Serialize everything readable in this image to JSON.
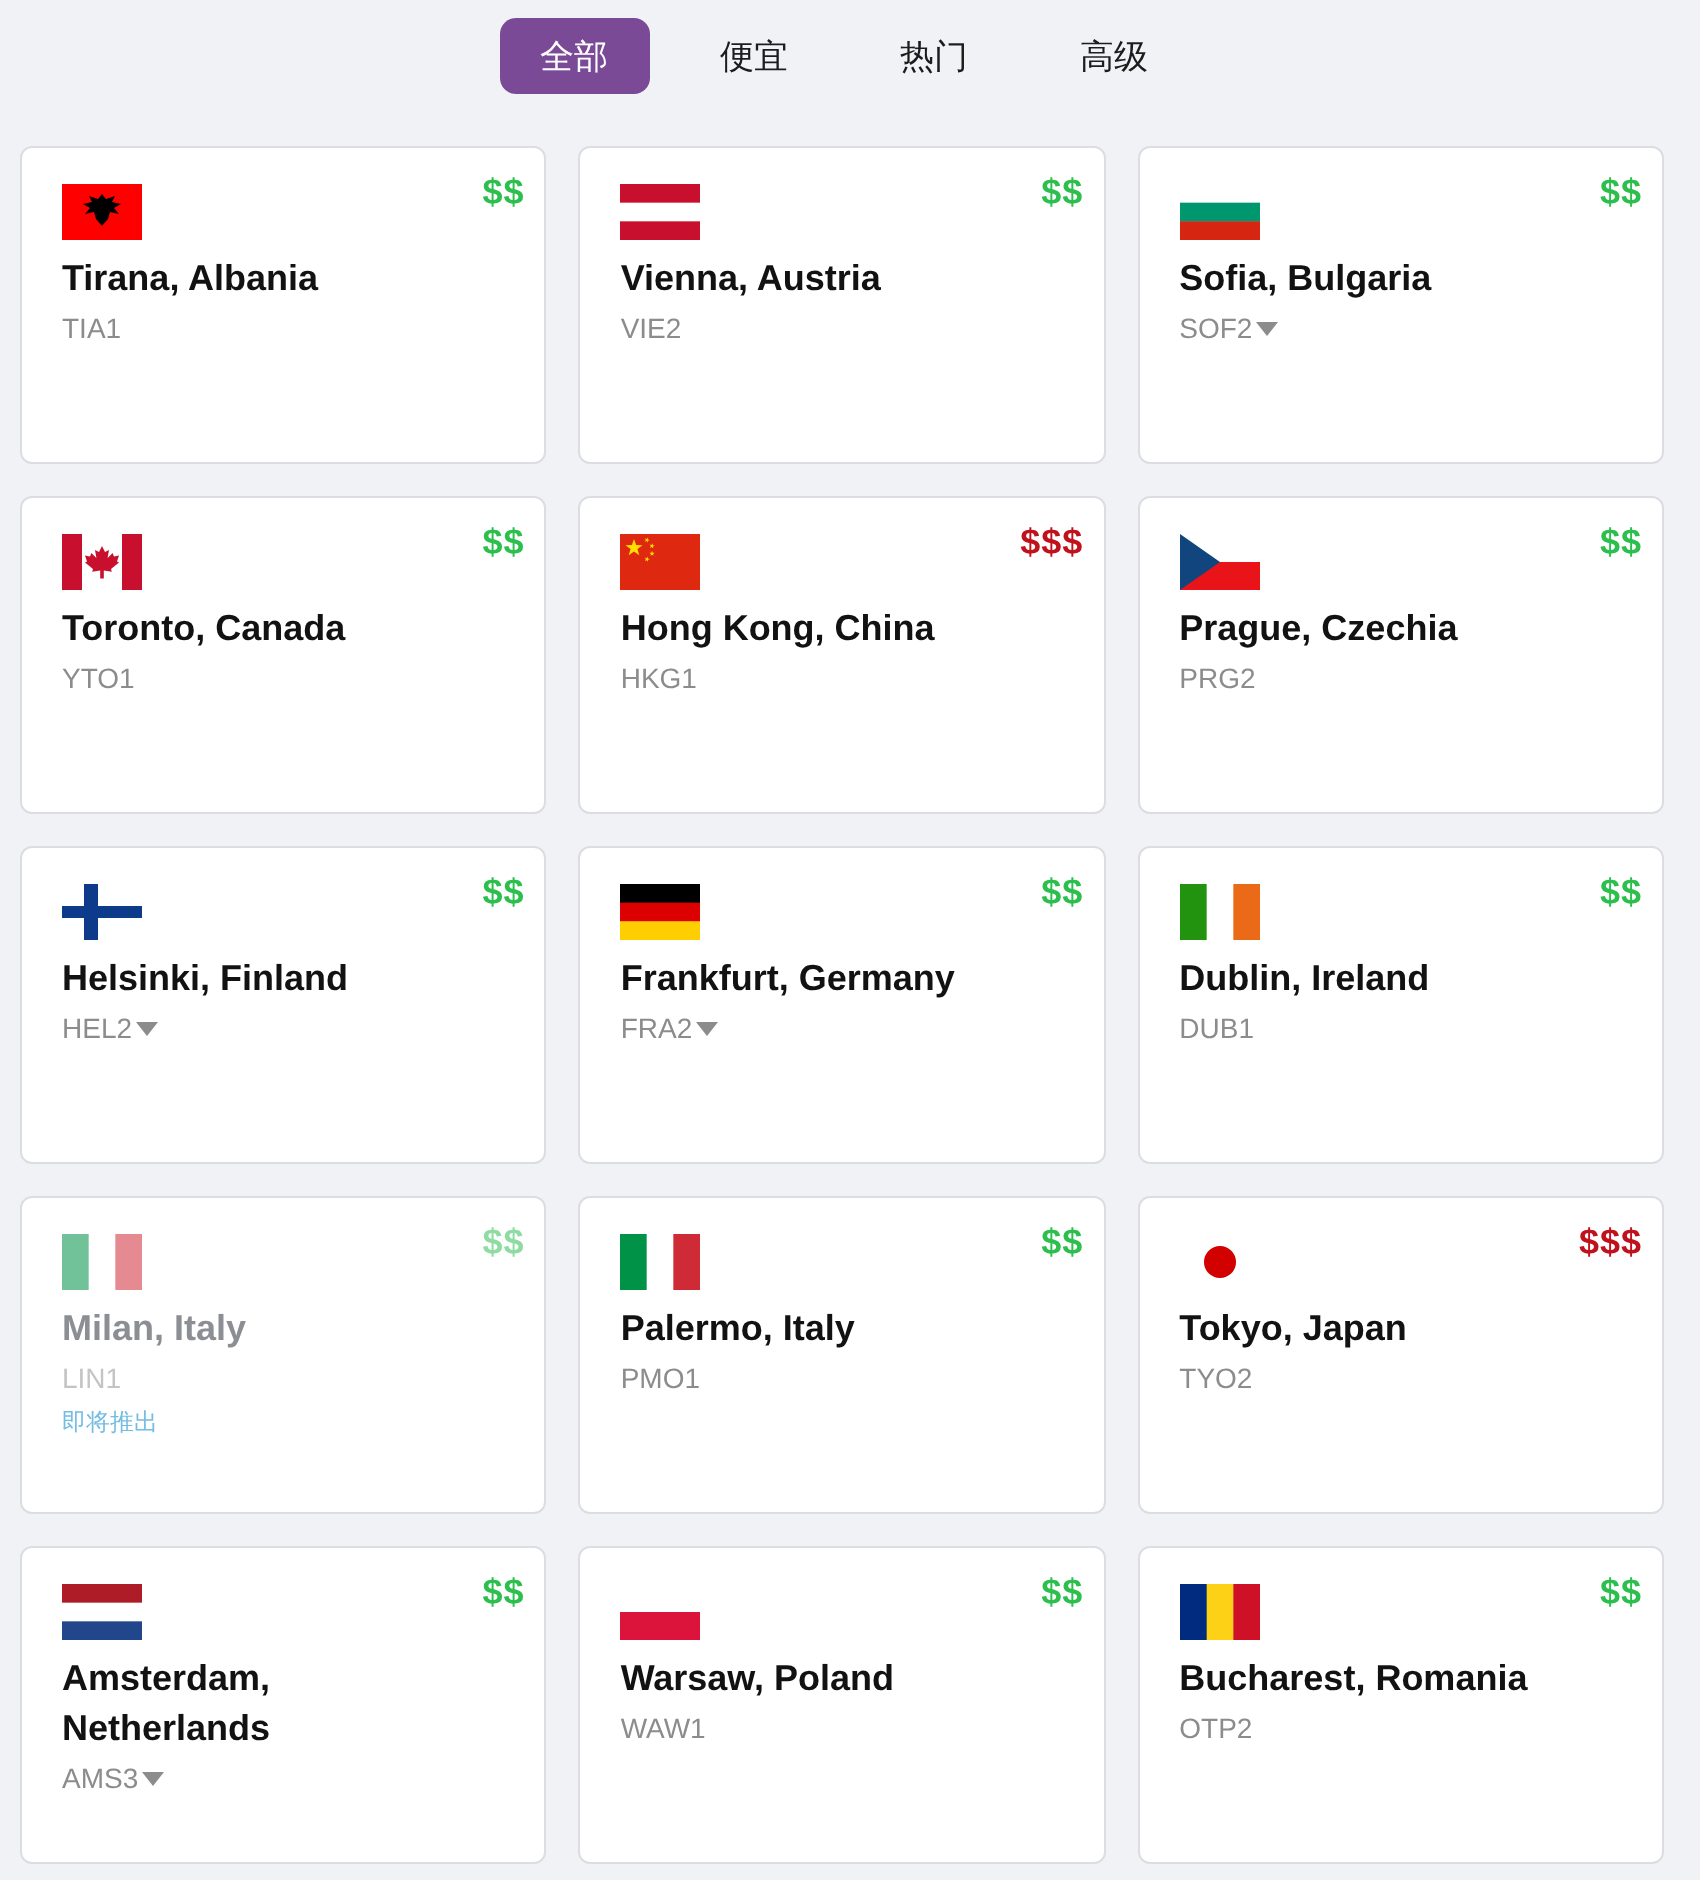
{
  "tabs": [
    {
      "label": "全部",
      "selected": true
    },
    {
      "label": "便宜",
      "selected": false
    },
    {
      "label": "热门",
      "selected": false
    },
    {
      "label": "高级",
      "selected": false
    }
  ],
  "cards": [
    {
      "kind": "albania",
      "price": "$$",
      "premium": false,
      "name": "Tirana, Albania",
      "code": "TIA1",
      "dropdown": false,
      "disabled": false
    },
    {
      "kind": "austria",
      "price": "$$",
      "premium": false,
      "name": "Vienna, Austria",
      "code": "VIE2",
      "dropdown": false,
      "disabled": false
    },
    {
      "kind": "bulgaria",
      "price": "$$",
      "premium": false,
      "name": "Sofia, Bulgaria",
      "code": "SOF2",
      "dropdown": true,
      "disabled": false
    },
    {
      "kind": "canada",
      "price": "$$",
      "premium": false,
      "name": "Toronto, Canada",
      "code": "YTO1",
      "dropdown": false,
      "disabled": false
    },
    {
      "kind": "china",
      "price": "$$$",
      "premium": true,
      "name": "Hong Kong, China",
      "code": "HKG1",
      "dropdown": false,
      "disabled": false
    },
    {
      "kind": "czechia",
      "price": "$$",
      "premium": false,
      "name": "Prague, Czechia",
      "code": "PRG2",
      "dropdown": false,
      "disabled": false
    },
    {
      "kind": "finland",
      "price": "$$",
      "premium": false,
      "name": "Helsinki, Finland",
      "code": "HEL2",
      "dropdown": true,
      "disabled": false
    },
    {
      "kind": "germany",
      "price": "$$",
      "premium": false,
      "name": "Frankfurt, Germany",
      "code": "FRA2",
      "dropdown": true,
      "disabled": false
    },
    {
      "kind": "ireland",
      "price": "$$",
      "premium": false,
      "name": "Dublin, Ireland",
      "code": "DUB1",
      "dropdown": false,
      "disabled": false
    },
    {
      "kind": "italy",
      "price": "$$",
      "premium": false,
      "name": "Milan, Italy",
      "code": "LIN1",
      "dropdown": false,
      "disabled": true,
      "note": "即将推出"
    },
    {
      "kind": "italy",
      "price": "$$",
      "premium": false,
      "name": "Palermo, Italy",
      "code": "PMO1",
      "dropdown": false,
      "disabled": false
    },
    {
      "kind": "japan",
      "price": "$$$",
      "premium": true,
      "name": "Tokyo, Japan",
      "code": "TYO2",
      "dropdown": false,
      "disabled": false
    },
    {
      "kind": "netherlands",
      "price": "$$",
      "premium": false,
      "name": "Amsterdam, Netherlands",
      "code": "AMS3",
      "dropdown": true,
      "disabled": false
    },
    {
      "kind": "poland",
      "price": "$$",
      "premium": false,
      "name": "Warsaw, Poland",
      "code": "WAW1",
      "dropdown": false,
      "disabled": false
    },
    {
      "kind": "romania",
      "price": "$$",
      "premium": false,
      "name": "Bucharest, Romania",
      "code": "OTP2",
      "dropdown": false,
      "disabled": false
    }
  ]
}
